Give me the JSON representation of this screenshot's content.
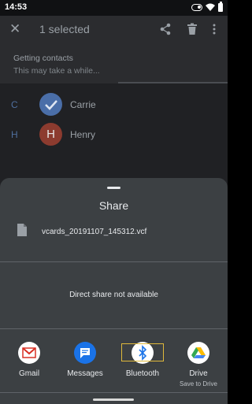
{
  "status_bar": {
    "time": "14:53"
  },
  "app_bar": {
    "title": "1 selected"
  },
  "loading": {
    "title": "Getting contacts",
    "subtitle": "This may take a while..."
  },
  "contacts": [
    {
      "letter": "C",
      "name": "Carrie",
      "avatar": "check",
      "avatar_color": "#4a6ea8"
    },
    {
      "letter": "H",
      "name": "Henry",
      "avatar": "H",
      "avatar_color": "#8c3b2f"
    }
  ],
  "share_sheet": {
    "title": "Share",
    "file_name": "vcards_20191107_145312.vcf",
    "direct_share": "Direct share not available",
    "targets": [
      {
        "label": "Gmail",
        "sub": "",
        "icon": "gmail-icon"
      },
      {
        "label": "Messages",
        "sub": "",
        "icon": "messages-icon",
        "color": "#1a73e8"
      },
      {
        "label": "Bluetooth",
        "sub": "",
        "icon": "bluetooth-icon",
        "color": "#ffffff"
      },
      {
        "label": "Drive",
        "sub": "Save to Drive",
        "icon": "drive-icon"
      }
    ]
  },
  "colors": {
    "sheet_bg": "#3c4043",
    "highlight": "#e0b93b",
    "accent": "#4a6ea8"
  }
}
